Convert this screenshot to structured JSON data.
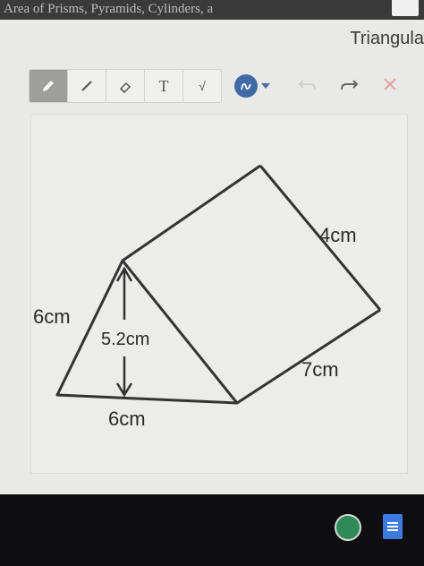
{
  "header": {
    "breadcrumb": "Area of Prisms, Pyramids, Cylinders, a"
  },
  "question": {
    "title": "Triangula"
  },
  "toolbar": {
    "tools": [
      "pencil-icon",
      "line-icon",
      "eraser-icon",
      "text-icon",
      "math-icon"
    ],
    "text_tool_label": "T",
    "math_tool_label": "√",
    "ink_color": "#3f6aa6",
    "undo": "undo-icon",
    "redo": "redo-icon",
    "clear": "clear-icon"
  },
  "figure": {
    "base_front": "6cm",
    "slant_side": "6cm",
    "height": "5.2cm",
    "length": "4cm",
    "edge_right": "7cm"
  }
}
